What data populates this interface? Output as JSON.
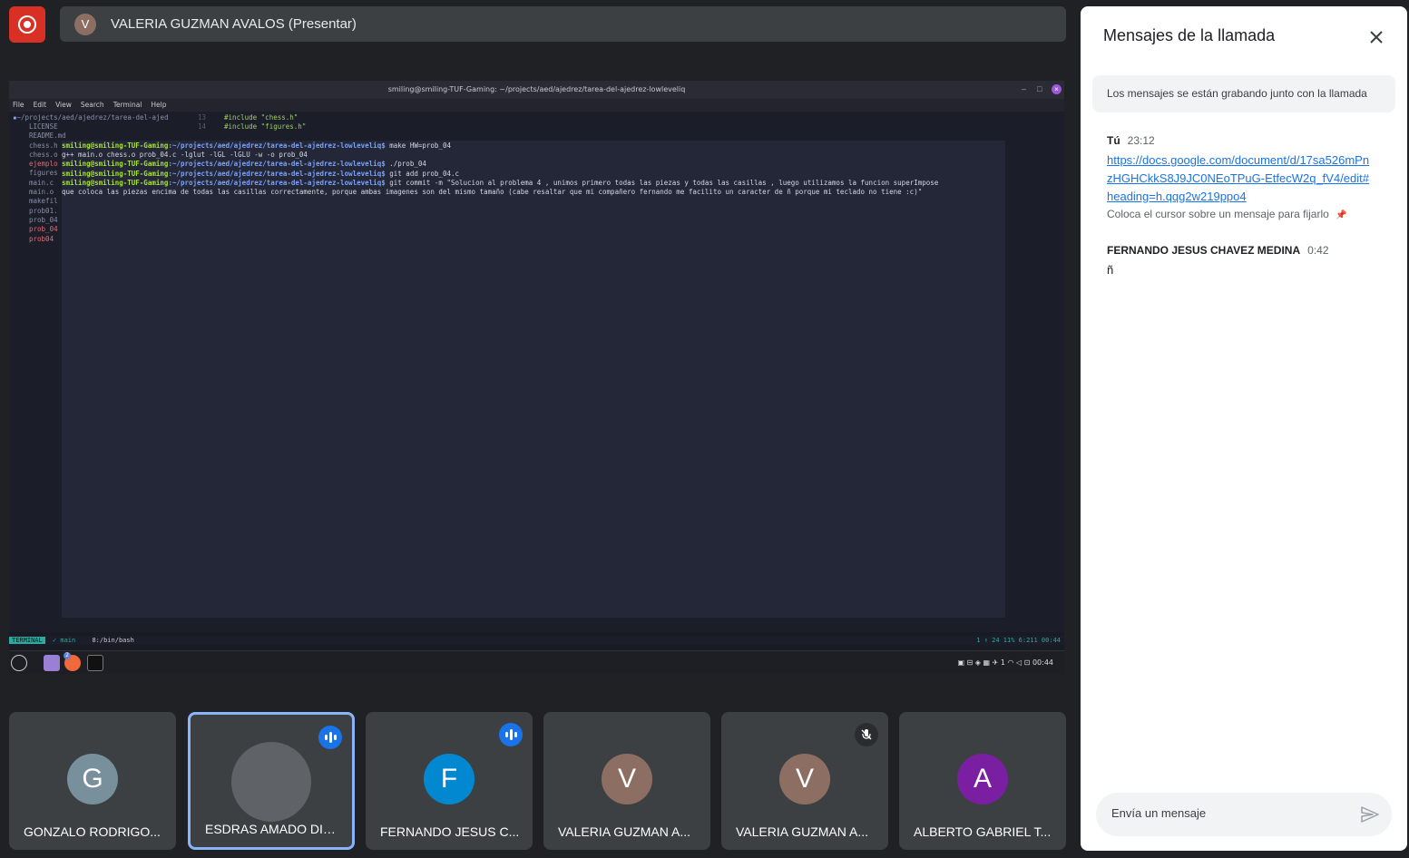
{
  "presenter": {
    "avatar_letter": "V",
    "name": "VALERIA GUZMAN AVALOS (Presentar)"
  },
  "screen": {
    "title": "smiling@smiling-TUF-Gaming: ~/projects/aed/ajedrez/tarea-del-ajedrez-lowleveliq",
    "menu": [
      "File",
      "Edit",
      "View",
      "Search",
      "Terminal",
      "Help"
    ],
    "tree_root": "~/projects/aed/ajedrez/tarea-del-ajed",
    "tree": [
      "LICENSE",
      "README.md",
      "chess.h",
      "chess.o",
      "ejemplo",
      "figures",
      "main.c",
      "main.o",
      "makefil",
      "prob01.",
      "prob_04",
      "prob_04",
      "prob04"
    ],
    "code": [
      {
        "num": "13",
        "text": "#include \"chess.h\""
      },
      {
        "num": "14",
        "text": "#include \"figures.h\""
      }
    ],
    "prompt_user": "smiling@smiling-TUF-Gaming",
    "prompt_path": ":~/projects/aed/ajedrez/tarea-del-ajedrez-lowleveliq$",
    "commands": [
      {
        "kind": "prompt",
        "cmd": " make HW=prob_04"
      },
      {
        "kind": "output",
        "text": "g++ main.o chess.o prob_04.c -lglut -lGL -lGLU -w -o prob_04"
      },
      {
        "kind": "prompt",
        "cmd": " ./prob_04"
      },
      {
        "kind": "prompt",
        "cmd": " git add prob_04.c"
      },
      {
        "kind": "prompt",
        "cmd": " git commit -m \"Solucion al problema 4 , unimos primero todas las piezas y todas las casillas , luego utilizamos la funcion superImpose"
      },
      {
        "kind": "output",
        "text": " que coloca las piezas encima de todas las casillas correctamente, porque ambas imagenes son del mismo tamaño (cabe resaltar que mi compañero fernando me facilito un caracter de ñ porque mi teclado no tiene :c)\""
      }
    ],
    "status_mode": "TERMINAL",
    "status_branch": "main",
    "status_shell": "8:/bin/bash",
    "status_right": "1 ↑ 24   11%  6:211  00:44",
    "tray_time": "00:44",
    "tray_badge": "2"
  },
  "participants": [
    {
      "name": "GONZALO RODRIGO...",
      "letter": "G",
      "color": "#78909c",
      "state": "none",
      "active": false
    },
    {
      "name": "ESDRAS AMADO DIA...",
      "letter": "",
      "color": "#9e9e9e",
      "state": "speaking",
      "active": true,
      "photo": true
    },
    {
      "name": "FERNANDO JESUS C...",
      "letter": "F",
      "color": "#0288d1",
      "state": "speaking",
      "active": false
    },
    {
      "name": "VALERIA GUZMAN A...",
      "letter": "V",
      "color": "#8d6e63",
      "state": "none",
      "active": false
    },
    {
      "name": "VALERIA GUZMAN A...",
      "letter": "V",
      "color": "#8d6e63",
      "state": "muted",
      "active": false
    },
    {
      "name": "ALBERTO GABRIEL T...",
      "letter": "A",
      "color": "#7b1fa2",
      "state": "none",
      "active": false
    }
  ],
  "chat": {
    "title": "Mensajes de la llamada",
    "notice": "Los mensajes se están grabando junto con la llamada",
    "messages": [
      {
        "sender": "Tú",
        "time": "23:12",
        "link": "https://docs.google.com/document/d/17sa526mPnzHGHCkkS8J9JC0NEoTPuG-EtfecW2q_fV4/edit#heading=h.qqg2w219ppo4",
        "hint": "Coloca el cursor sobre un mensaje para fijarlo"
      },
      {
        "sender": "FERNANDO JESUS CHAVEZ MEDINA",
        "time": "0:42",
        "text": "ñ"
      }
    ],
    "input_placeholder": "Envía un mensaje"
  },
  "colors": {
    "accent": "#1a73e8",
    "record": "#d93025",
    "active_border": "#8ab4f8"
  }
}
